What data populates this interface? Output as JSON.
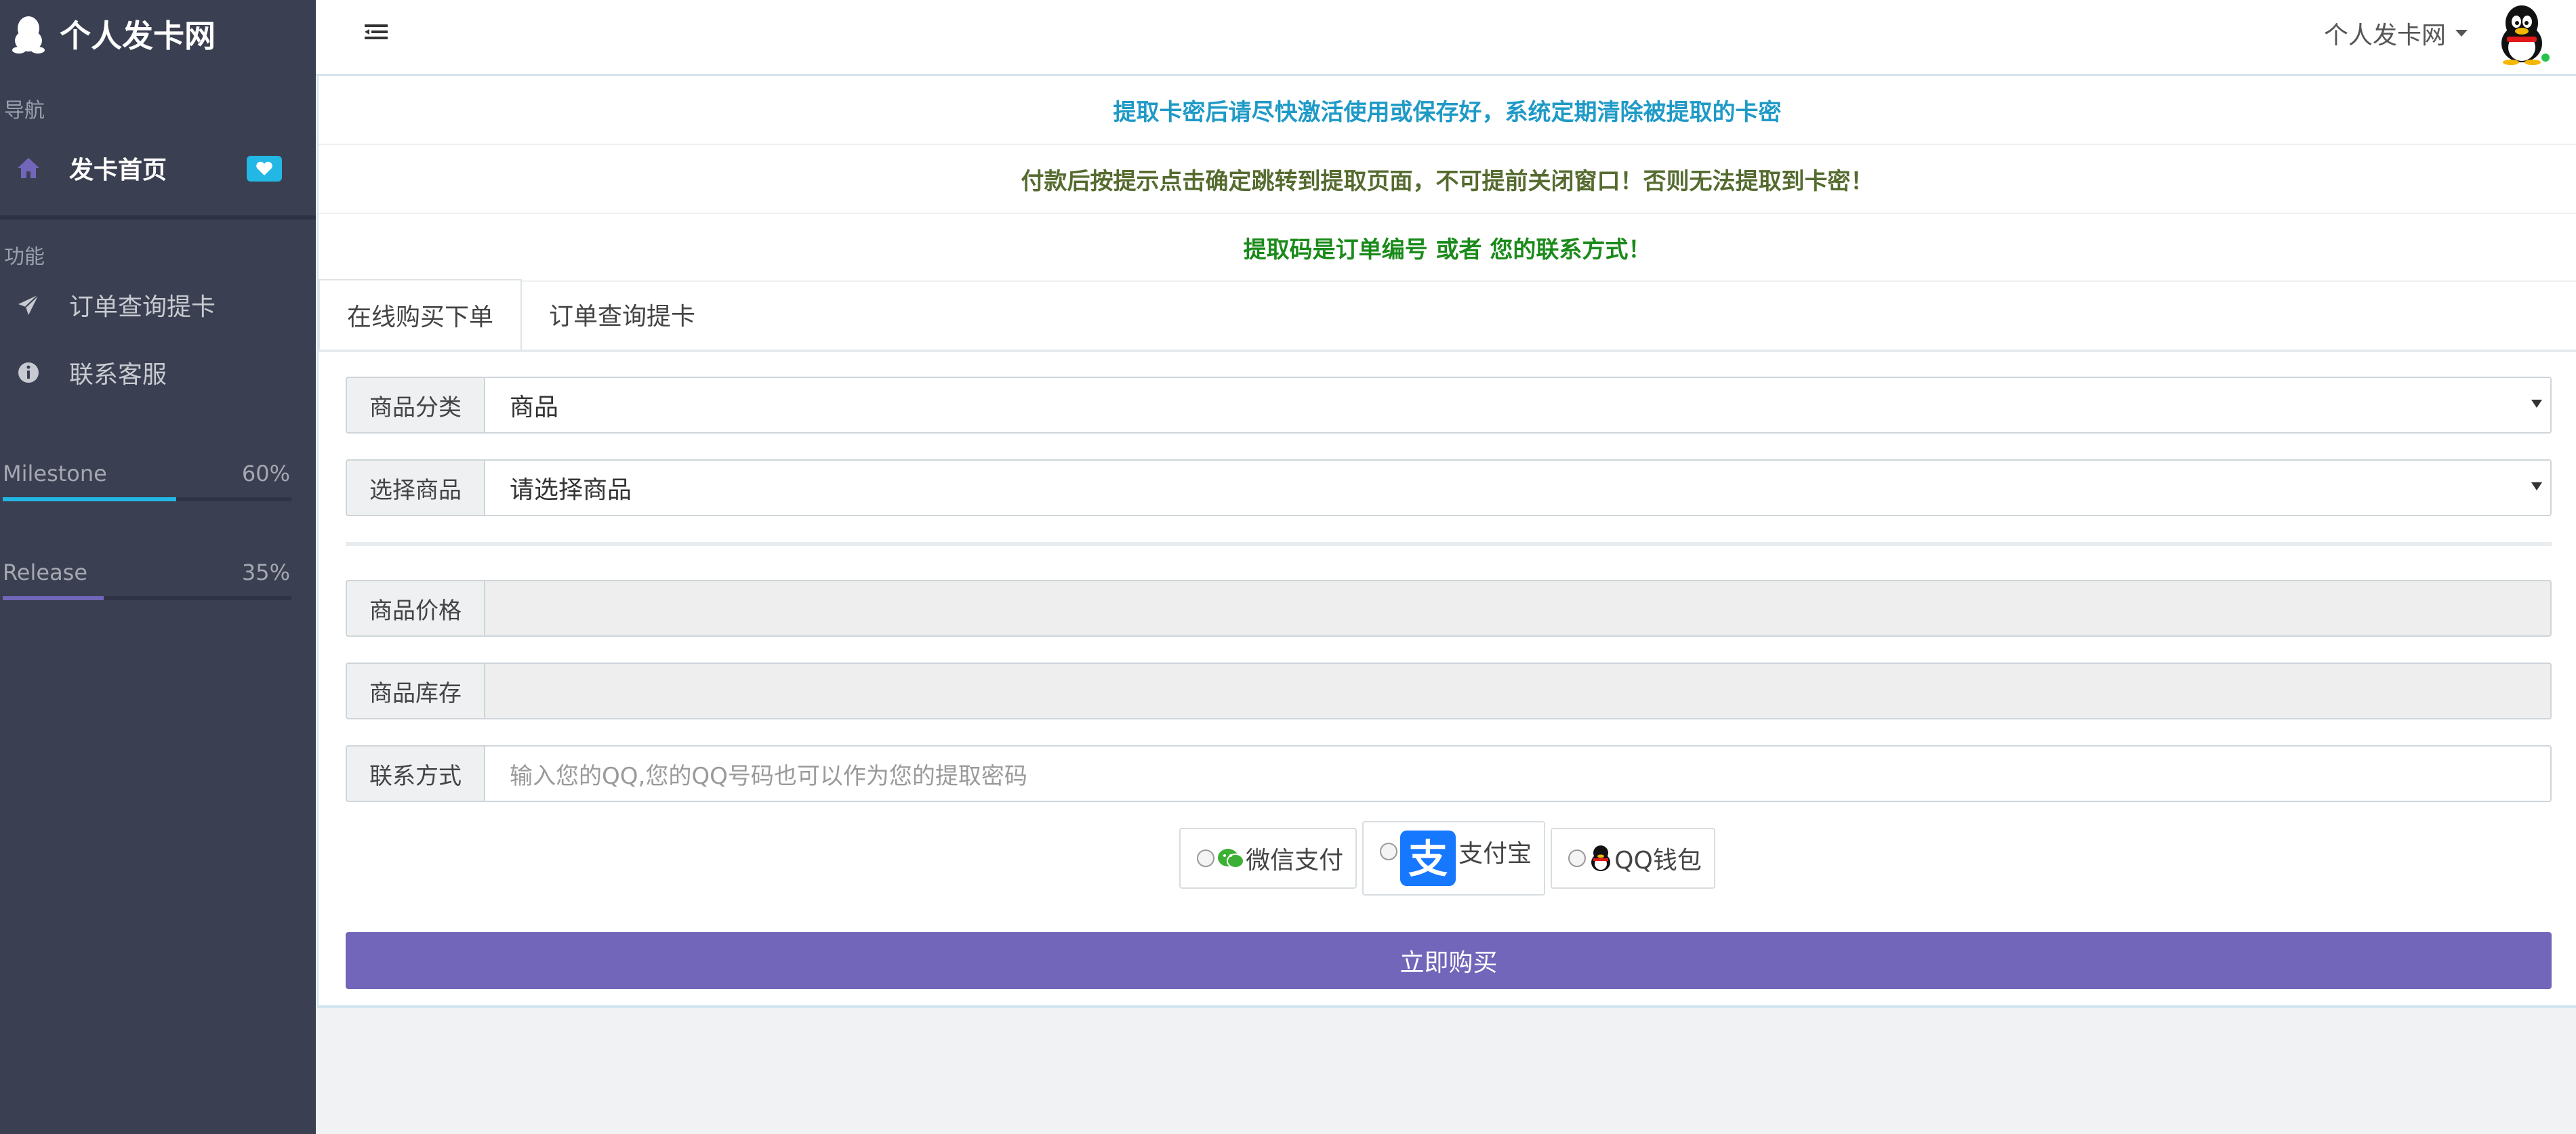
{
  "brand": {
    "title": "个人发卡网"
  },
  "sidebar": {
    "nav_header": "导航",
    "home": {
      "label": "发卡首页"
    },
    "func_header": "功能",
    "items": [
      {
        "label": "订单查询提卡",
        "icon": "send-icon"
      },
      {
        "label": "联系客服",
        "icon": "info-icon"
      }
    ],
    "progress": [
      {
        "label": "Milestone",
        "percent_text": "60%",
        "value": 0.6,
        "color": "#23b7e5"
      },
      {
        "label": "Release",
        "percent_text": "35%",
        "value": 0.35,
        "color": "#7266ba"
      }
    ]
  },
  "header": {
    "site_menu": "个人发卡网"
  },
  "notices": [
    "提取卡密后请尽快激活使用或保存好，系统定期清除被提取的卡密",
    "付款后按提示点击确定跳转到提取页面，不可提前关闭窗口！否则无法提取到卡密！",
    "提取码是订单编号 或者 您的联系方式！"
  ],
  "tabs": [
    "在线购买下单",
    "订单查询提卡"
  ],
  "form": {
    "category_label": "商品分类",
    "category_value": "商品",
    "product_label": "选择商品",
    "product_value": "请选择商品",
    "price_label": "商品价格",
    "price_value": "",
    "stock_label": "商品库存",
    "stock_value": "",
    "contact_label": "联系方式",
    "contact_placeholder": "输入您的QQ,您的QQ号码也可以作为您的提取密码"
  },
  "payment": {
    "wechat": "微信支付",
    "alipay": "支付宝",
    "qq": "QQ钱包"
  },
  "buy_button": "立即购买",
  "colors": {
    "sidebar_bg": "#3a3f51",
    "primary": "#7266ba",
    "info": "#23b7e5"
  }
}
